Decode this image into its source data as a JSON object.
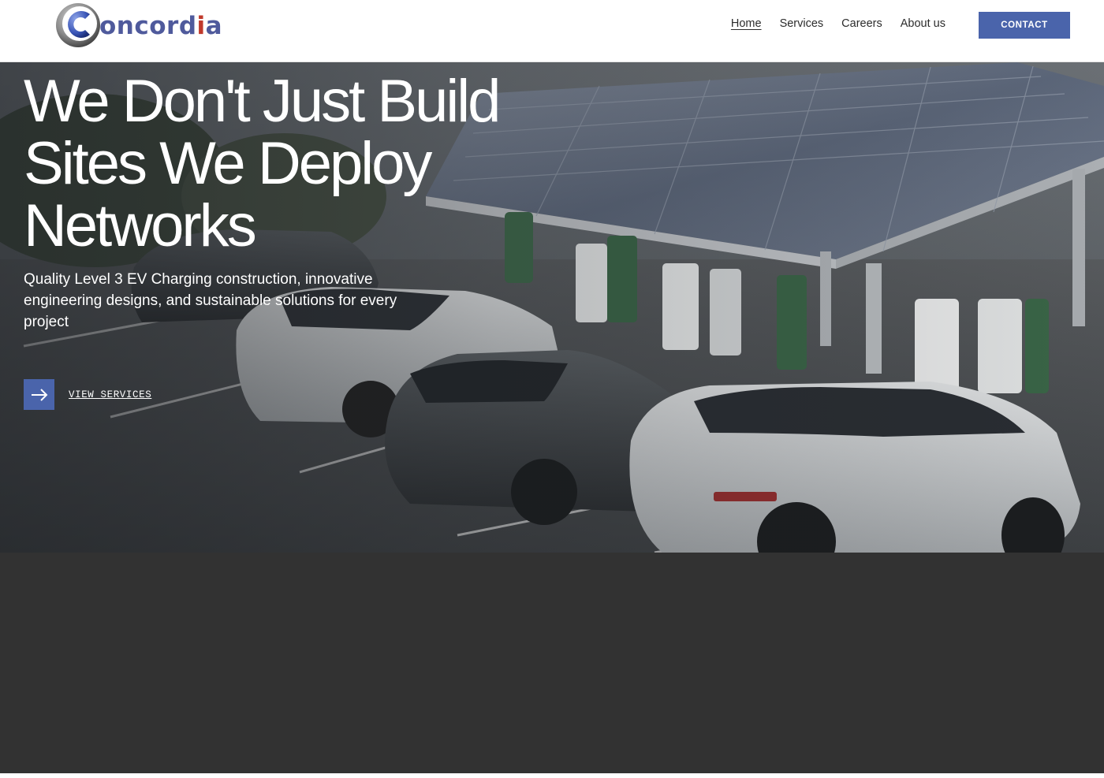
{
  "brand": {
    "name_main": "oncord",
    "name_accent": "i",
    "name_end": "a",
    "logo_icon": "concordia-c-logo",
    "colors": {
      "primary": "#4a64ab",
      "logo_text": "#4f5a9c",
      "logo_accent": "#c0392b"
    }
  },
  "nav": {
    "items": [
      {
        "label": "Home",
        "active": true
      },
      {
        "label": "Services",
        "active": false
      },
      {
        "label": "Careers",
        "active": false
      },
      {
        "label": "About us",
        "active": false
      }
    ],
    "contact_label": "CONTACT"
  },
  "hero": {
    "title_line1": "We Don't Just Build",
    "title_line2": "Sites We Deploy",
    "title_line3": "Networks",
    "subtitle": "Quality Level 3 EV Charging construction, innovative engineering designs, and sustainable solutions for every project",
    "cta_label": "VIEW SERVICES",
    "cta_icon": "arrow-right-icon",
    "background_image": "ev-charging-station-solar-carport-photo"
  }
}
